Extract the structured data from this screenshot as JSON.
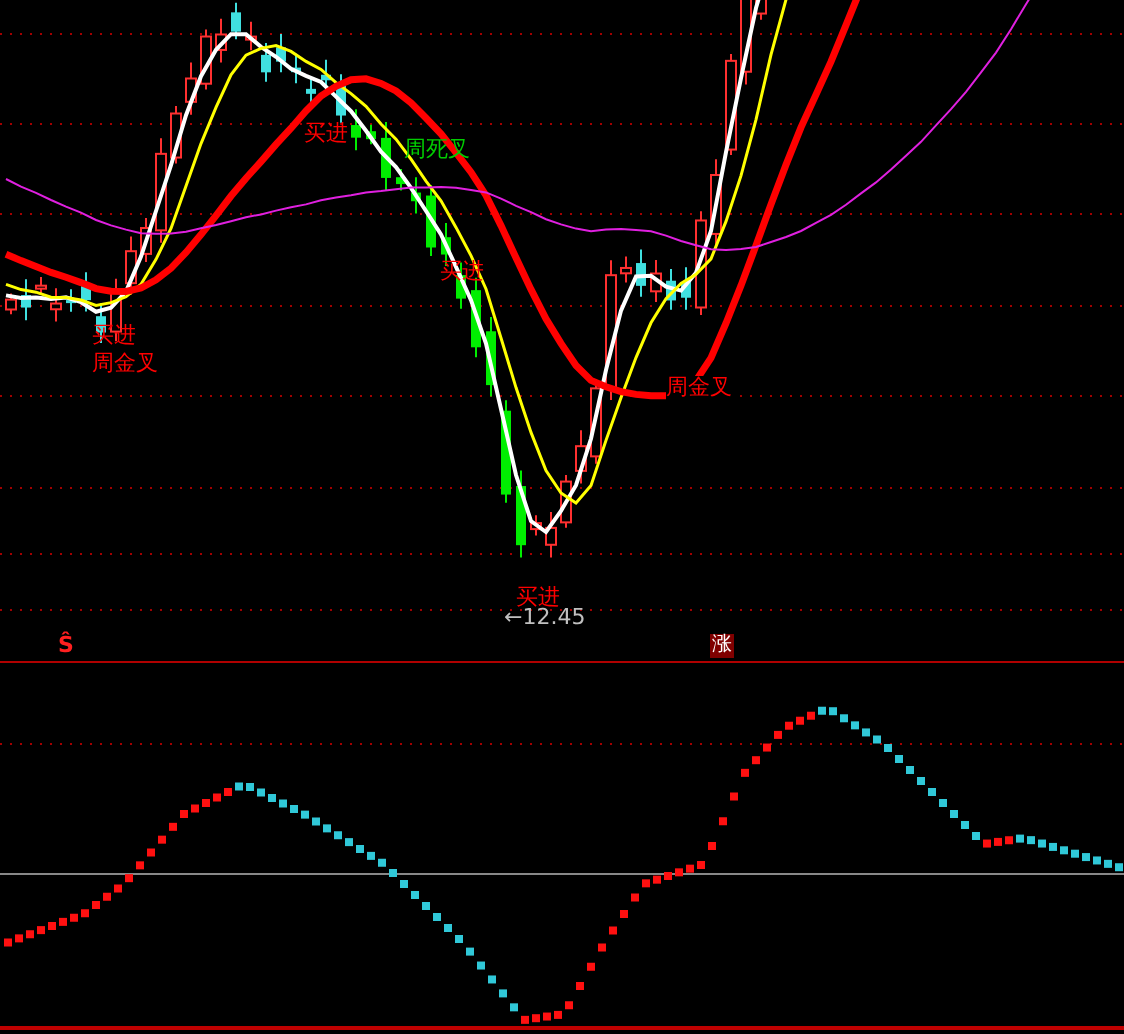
{
  "chart": {
    "signals": [
      {
        "text": "买进",
        "color": "#ff0000"
      },
      {
        "text": "周金叉",
        "color": "#ff0000"
      },
      {
        "text": "买进",
        "color": "#ff0000"
      },
      {
        "text": "周死叉",
        "color": "#00cc00"
      },
      {
        "text": "买进",
        "color": "#ff0000"
      },
      {
        "text": "买进",
        "color": "#ff0000"
      },
      {
        "text": "周金叉",
        "color": "#ff0000"
      }
    ],
    "low_price_marker": "←12.45"
  },
  "indicator_header": {
    "marker": "Ŝ",
    "badge": "涨"
  }
}
